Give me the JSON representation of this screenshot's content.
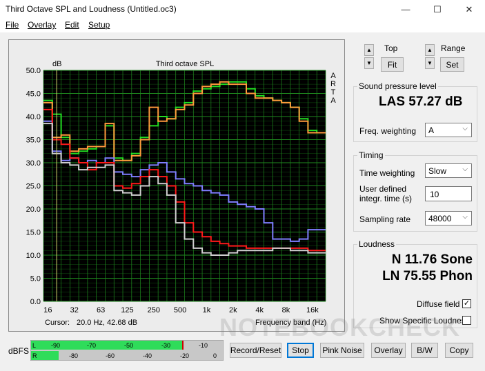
{
  "window": {
    "title": "Third Octave SPL and Loudness (Untitled.oc3)",
    "minimize_glyph": "—",
    "maximize_glyph": "☐",
    "close_glyph": "✕"
  },
  "menu": {
    "file": "File",
    "overlay": "Overlay",
    "edit": "Edit",
    "setup": "Setup"
  },
  "chart": {
    "title": "Third octave SPL",
    "ylabel_unit": "dB",
    "right_letters": [
      "A",
      "R",
      "T",
      "A"
    ],
    "y_ticks": [
      "50.0",
      "45.0",
      "40.0",
      "35.0",
      "30.0",
      "25.0",
      "20.0",
      "15.0",
      "10.0",
      "5.0",
      "0.0"
    ],
    "x_ticks": [
      "16",
      "32",
      "63",
      "125",
      "250",
      "500",
      "1k",
      "2k",
      "4k",
      "8k",
      "16k"
    ],
    "cursor_label": "Cursor:",
    "cursor_value": "20.0 Hz, 42.68 dB",
    "xlabel": "Frequency band (Hz)"
  },
  "chart_data": {
    "type": "line",
    "title": "Third octave SPL",
    "xlabel": "Frequency band (Hz)",
    "ylabel": "dB",
    "ylim": [
      0,
      50
    ],
    "grid": true,
    "colors": {
      "background": "#000000",
      "grid": "#1f8a1f",
      "green": "#22dd22",
      "orange": "#ff9a3c",
      "blue": "#7f7fff",
      "red": "#ff1a1a",
      "white": "#cfcfcf"
    },
    "categories": [
      "16",
      "20",
      "25",
      "31.5",
      "40",
      "50",
      "63",
      "80",
      "100",
      "125",
      "160",
      "200",
      "250",
      "315",
      "400",
      "500",
      "630",
      "800",
      "1k",
      "1.25k",
      "1.6k",
      "2k",
      "2.5k",
      "3.15k",
      "4k",
      "5k",
      "6.3k",
      "8k",
      "10k",
      "12.5k",
      "16k",
      "20k"
    ],
    "series": [
      {
        "color": "green",
        "values": [
          43.5,
          40.5,
          35.5,
          32.0,
          32.5,
          33.0,
          33.5,
          38.0,
          31.0,
          30.5,
          32.0,
          35.5,
          38.0,
          40.0,
          39.5,
          42.0,
          43.0,
          45.5,
          46.0,
          46.5,
          47.0,
          47.5,
          47.5,
          46.0,
          44.5,
          44.0,
          43.5,
          43.0,
          42.0,
          39.5,
          37.0,
          36.5
        ]
      },
      {
        "color": "orange",
        "values": [
          43.0,
          35.5,
          36.0,
          32.5,
          33.0,
          33.5,
          33.5,
          38.5,
          30.5,
          30.5,
          31.5,
          35.0,
          42.0,
          39.0,
          39.5,
          41.5,
          42.5,
          45.0,
          46.5,
          47.0,
          47.5,
          47.0,
          47.0,
          45.0,
          44.0,
          44.0,
          43.5,
          43.0,
          42.0,
          39.0,
          36.5,
          36.5
        ]
      },
      {
        "color": "blue",
        "values": [
          39.0,
          32.5,
          30.5,
          31.0,
          30.0,
          30.5,
          30.0,
          31.0,
          28.0,
          27.5,
          27.0,
          28.5,
          29.5,
          30.0,
          28.0,
          26.5,
          25.5,
          25.0,
          24.0,
          23.5,
          23.0,
          21.5,
          21.0,
          20.5,
          20.0,
          17.0,
          13.5,
          13.5,
          13.0,
          13.5,
          15.5,
          15.5
        ]
      },
      {
        "color": "red",
        "values": [
          41.5,
          35.0,
          34.0,
          31.0,
          30.0,
          28.5,
          30.0,
          30.0,
          25.0,
          24.5,
          25.5,
          27.0,
          28.5,
          27.0,
          25.0,
          21.5,
          17.0,
          15.0,
          14.0,
          13.0,
          12.5,
          12.0,
          12.0,
          11.5,
          11.5,
          11.5,
          11.5,
          11.5,
          11.5,
          11.5,
          11.0,
          11.0
        ]
      },
      {
        "color": "white",
        "values": [
          38.5,
          32.0,
          30.0,
          29.5,
          28.5,
          29.0,
          29.0,
          29.5,
          24.0,
          23.5,
          23.0,
          25.0,
          27.0,
          25.5,
          23.0,
          17.0,
          13.5,
          11.5,
          10.5,
          10.0,
          10.0,
          10.5,
          11.0,
          11.0,
          11.0,
          11.0,
          11.5,
          11.5,
          11.0,
          11.0,
          10.5,
          10.5
        ]
      }
    ]
  },
  "right_panel": {
    "top_label": "Top",
    "fit_label": "Fit",
    "range_label": "Range",
    "set_label": "Set",
    "spl_group_title": "Sound pressure level",
    "spl_value": "LAS 57.27 dB",
    "freq_weighting_label": "Freq. weighting",
    "freq_weighting_value": "A",
    "timing_group_title": "Timing",
    "time_weighting_label": "Time weighting",
    "time_weighting_value": "Slow",
    "user_defined_label_1": "User defined",
    "user_defined_label_2": "integr. time (s)",
    "user_defined_value": "10",
    "sampling_rate_label": "Sampling rate",
    "sampling_rate_value": "48000",
    "loudness_group_title": "Loudness",
    "loudness_n": "N 11.76 Sone",
    "loudness_ln": "LN 75.55 Phon",
    "diffuse_field_label": "Diffuse field",
    "diffuse_field_checked": true,
    "show_specific_label": "Show Specific Loudness",
    "show_specific_checked": false
  },
  "bottom": {
    "dbfs_label": "dBFS",
    "channel_l": "L",
    "channel_r": "R",
    "meter_l_ticks": [
      "-90",
      "-70",
      "-50",
      "-30",
      "-10"
    ],
    "meter_r_ticks": [
      "-80",
      "-60",
      "-40",
      "-20",
      "0"
    ],
    "buttons": {
      "record_reset": "Record/Reset",
      "stop": "Stop",
      "pink_noise": "Pink Noise",
      "overlay": "Overlay",
      "bw": "B/W",
      "copy": "Copy"
    }
  },
  "watermark": "NOTEBOOKCHECK"
}
